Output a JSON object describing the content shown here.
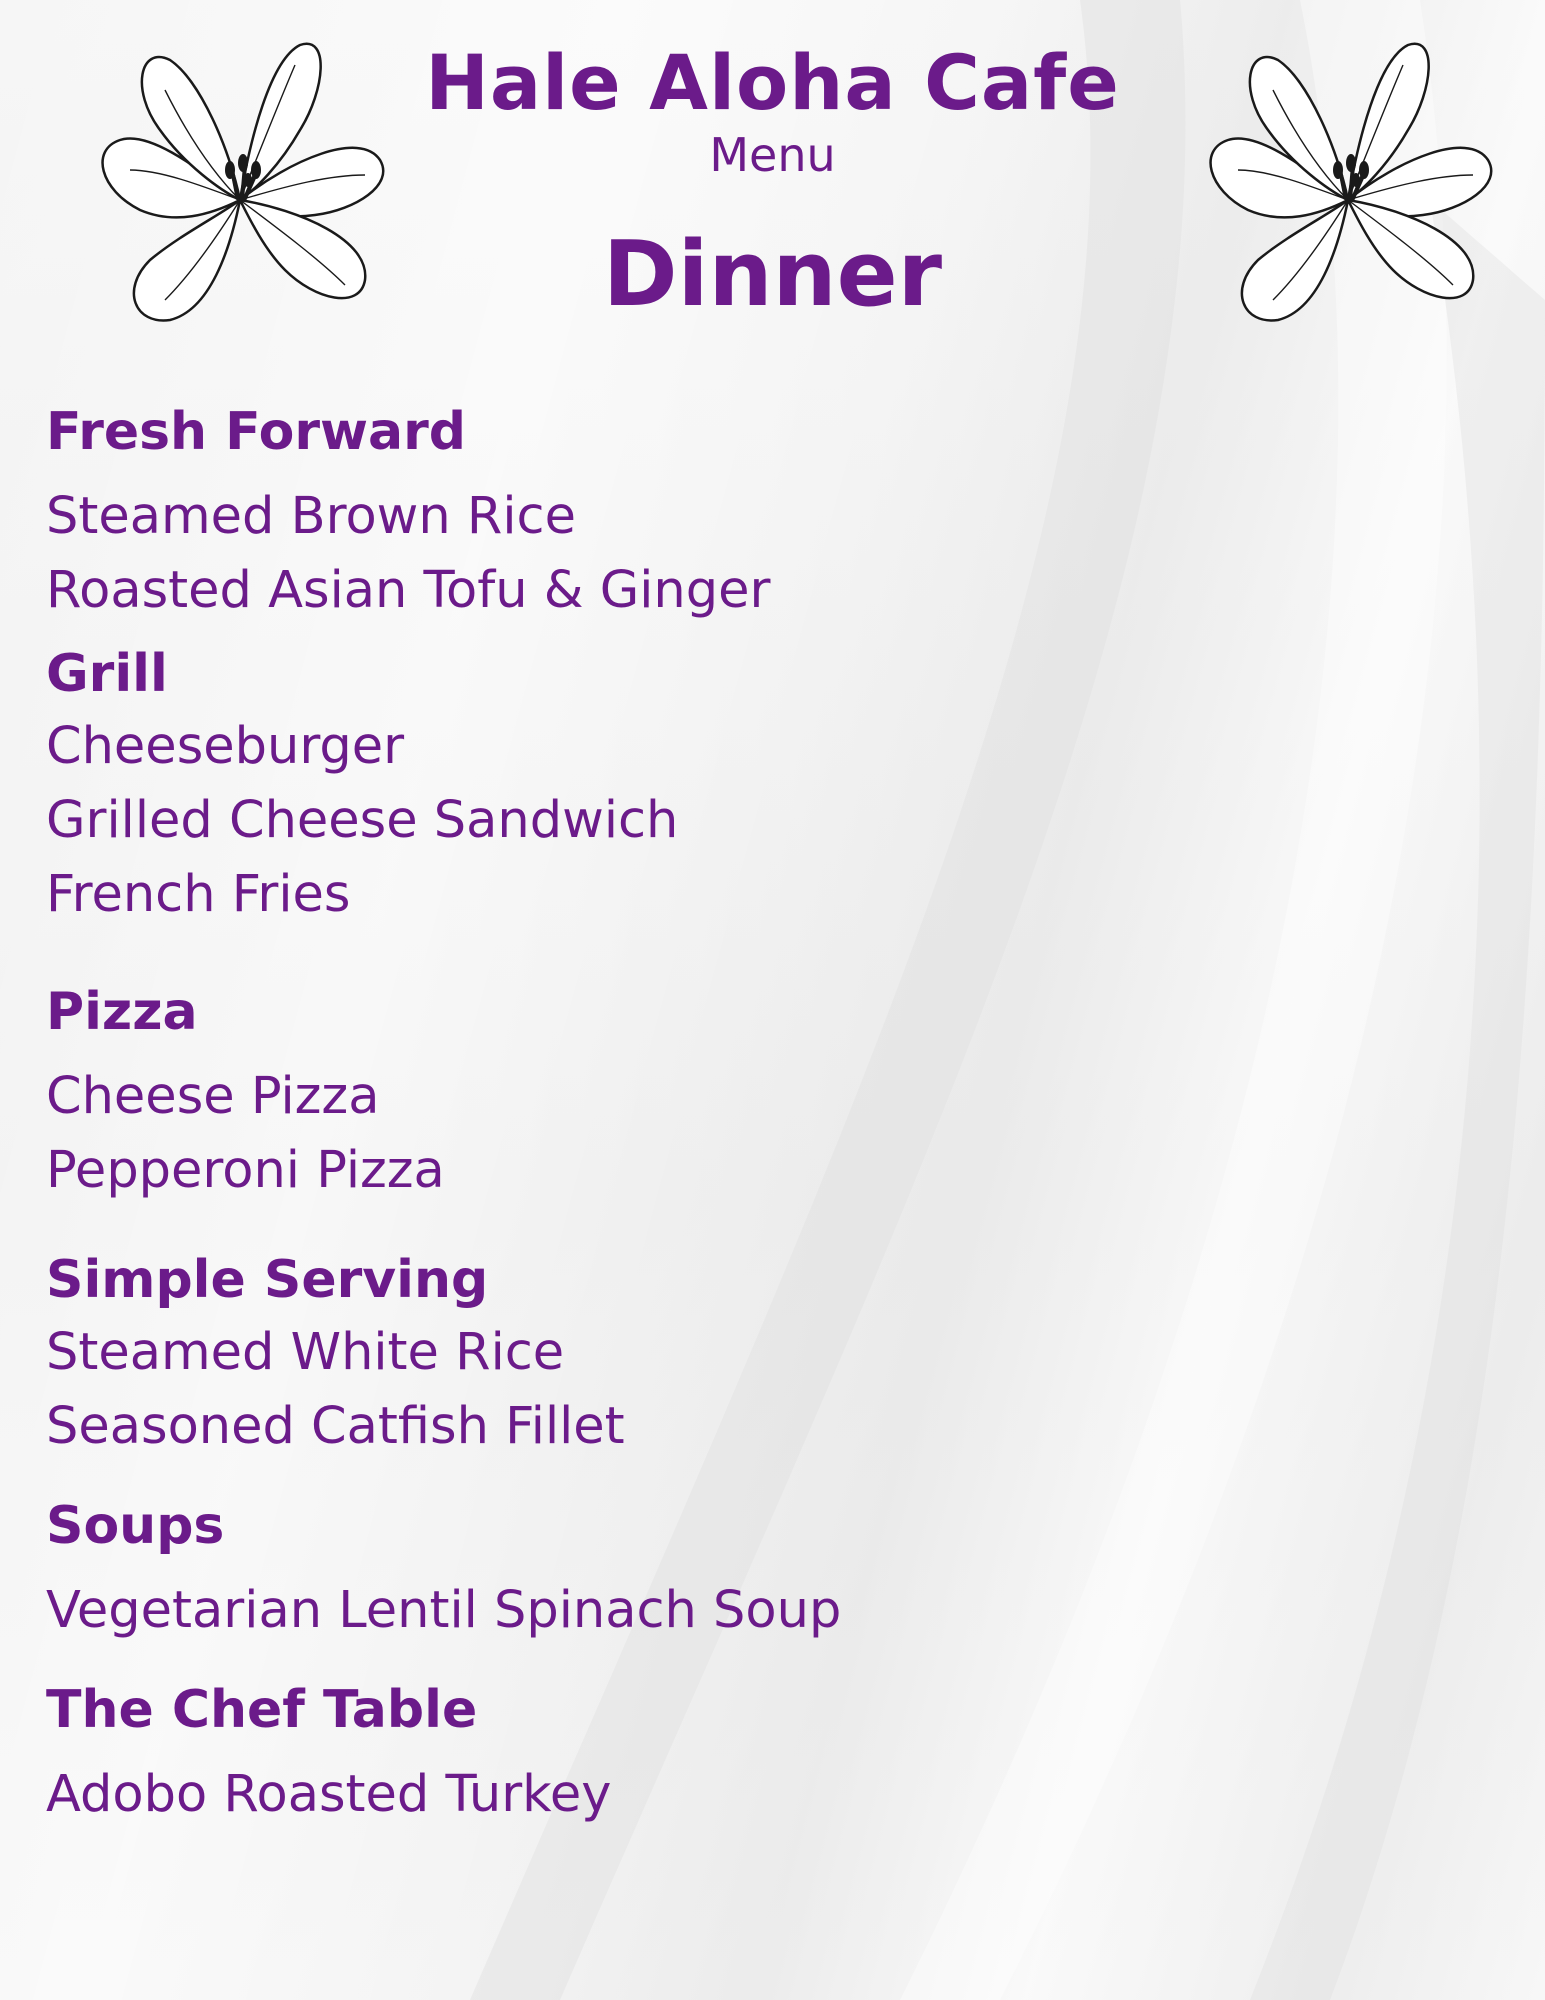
{
  "header": {
    "cafe_name": "Hale Aloha Cafe",
    "menu_label": "Menu",
    "meal_title": "Dinner"
  },
  "colors": {
    "accent": "#6b1b8a",
    "background": "#f3f3f3",
    "flower_stroke": "#1a1a1a"
  },
  "decor": {
    "left_icon": "hibiscus-flower-icon",
    "right_icon": "hibiscus-flower-icon"
  },
  "sections": [
    {
      "title": "Fresh Forward",
      "items": [
        "Steamed Brown Rice",
        "Roasted Asian Tofu & Ginger"
      ]
    },
    {
      "title": "Grill",
      "items": [
        "Cheeseburger",
        "Grilled Cheese Sandwich",
        "French Fries"
      ]
    },
    {
      "title": "Pizza",
      "items": [
        "Cheese Pizza",
        "Pepperoni Pizza"
      ]
    },
    {
      "title": "Simple Serving",
      "items": [
        "Steamed White Rice",
        "Seasoned Catfish Fillet"
      ]
    },
    {
      "title": "Soups",
      "items": [
        "Vegetarian Lentil Spinach Soup"
      ]
    },
    {
      "title": "The Chef Table",
      "items": [
        "Adobo Roasted Turkey"
      ]
    }
  ]
}
